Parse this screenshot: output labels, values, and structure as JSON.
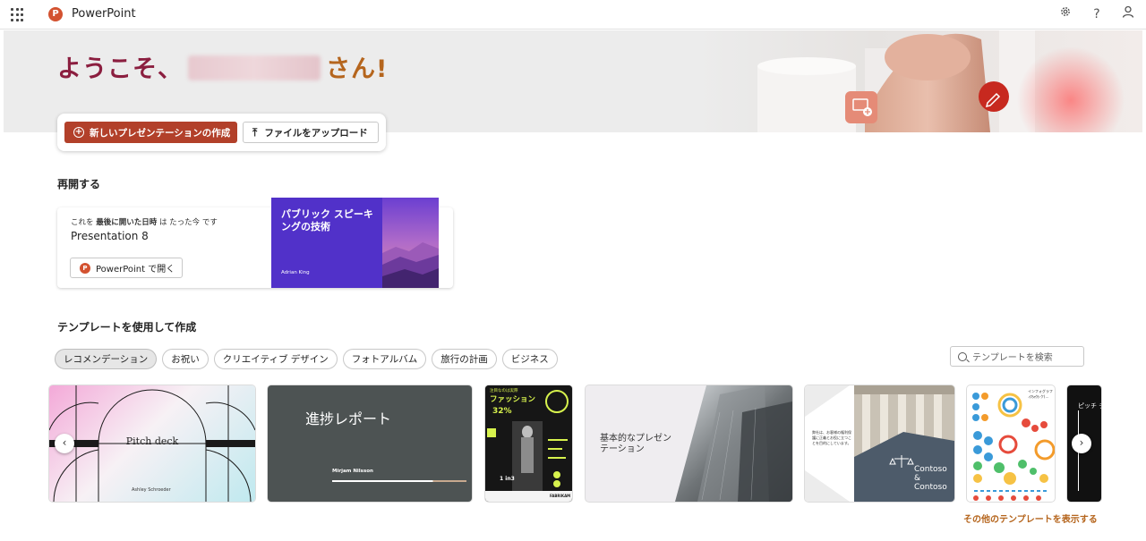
{
  "app": {
    "name": "PowerPoint",
    "logo_letter": "P"
  },
  "topbar": {
    "settings_icon": "gear-icon",
    "help_label": "?",
    "account_icon": "person-icon"
  },
  "hero": {
    "welcome_prefix": "ようこそ、",
    "welcome_suffix": "さん!",
    "new_button_label": "新しいプレゼンテーションの作成",
    "upload_button_label": "ファイルをアップロード"
  },
  "resume": {
    "section_title": "再開する",
    "meta_prefix": "これを",
    "meta_bold": "最後に開いた日時",
    "meta_suffix": "は たった今 です",
    "file_name": "Presentation 8",
    "open_button_label": "PowerPoint で開く",
    "thumb_title": "パブリック スピーキングの技術",
    "thumb_author": "Adrian King"
  },
  "templates": {
    "section_title": "テンプレートを使用して作成",
    "filters": [
      "レコメンデーション",
      "お祝い",
      "クリエイティブ デザイン",
      "フォトアルバム",
      "旅行の計画",
      "ビジネス"
    ],
    "search_placeholder": "テンプレートを検索",
    "items": [
      {
        "title": "Pitch deck",
        "author": "Ashley Schroeder"
      },
      {
        "title": "進捗レポート",
        "author": "Mirjam Nilsson"
      },
      {
        "title": "ファッション",
        "stat": "32%",
        "sub": "1 in3",
        "brand": "FABRIKAM",
        "kicker": "注目なのは実際"
      },
      {
        "title": "基本的なプレゼンテーション"
      },
      {
        "title": "Contoso & Contoso",
        "body": "弊社は、お客様の権利保護に正義とお役に立つことを目的にしています。"
      },
      {
        "title": "インフォグラフィック",
        "subtitle": "フィック(…"
      },
      {
        "title": "ピッチ デ"
      }
    ],
    "more_link": "その他のテンプレートを表示する"
  },
  "colors": {
    "accent": "#b2402a",
    "welcome": "#8b1e3f",
    "link": "#b5651d",
    "ppt": "#d35230"
  }
}
